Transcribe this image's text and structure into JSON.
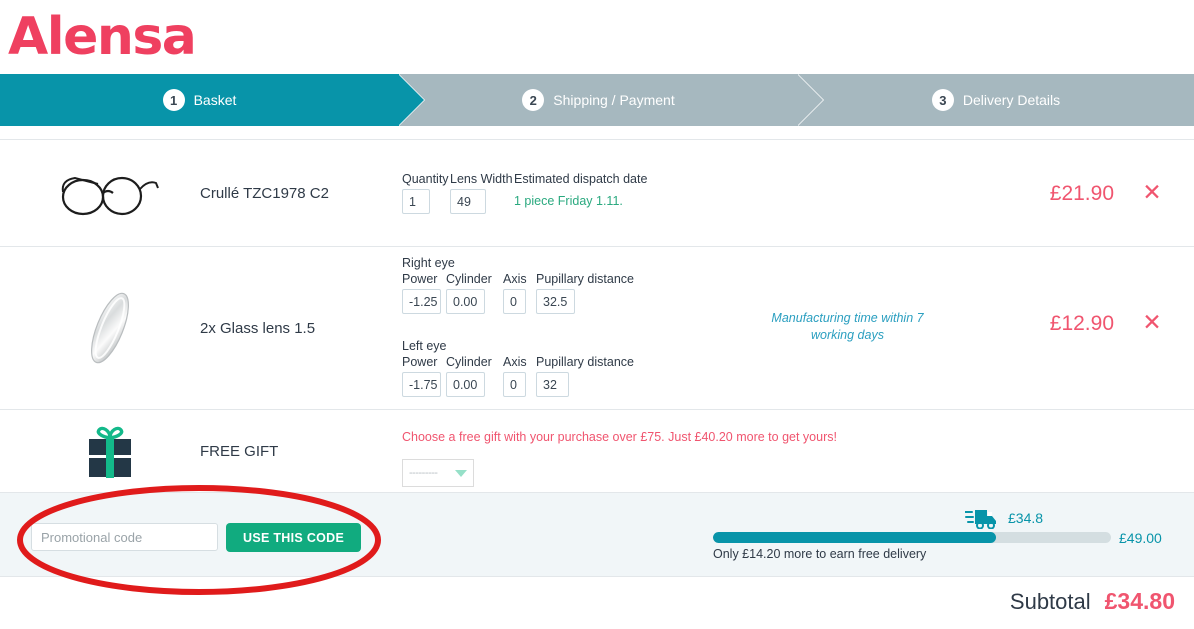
{
  "brand": {
    "name": "Alensa",
    "color": "#ef4060"
  },
  "theme": {
    "teal": "#0894a9",
    "grey_step": "#a6b8bf",
    "price_red": "#f0556f",
    "green_button": "#11ab7f",
    "dispatch_green": "#2aa97f",
    "note_blue": "#2b9fc0",
    "annotation_red": "#e01b1b"
  },
  "steps": [
    {
      "number": "1",
      "label": "Basket",
      "state": "active"
    },
    {
      "number": "2",
      "label": "Shipping / Payment",
      "state": "inactive"
    },
    {
      "number": "3",
      "label": "Delivery Details",
      "state": "inactive"
    }
  ],
  "items": [
    {
      "name": "Crullé TZC1978 C2",
      "thumb_icon": "eyeglasses-image",
      "price": "£21.90",
      "remove_label": "✕",
      "fields": [
        {
          "label": "Quantity",
          "value": "1"
        },
        {
          "label": "Lens Width",
          "value": "49"
        }
      ],
      "dispatch_header": "Estimated dispatch date",
      "dispatch_pieces": "1 piece",
      "dispatch_date": "Friday 1.11."
    },
    {
      "name": "2x Glass lens 1.5",
      "thumb_icon": "glass-lens-image",
      "price": "£12.90",
      "remove_label": "✕",
      "right_eye": {
        "title": "Right eye",
        "columns": [
          "Power",
          "Cylinder",
          "Axis",
          "Pupillary distance"
        ],
        "values": [
          "-1.25",
          "0.00",
          "0",
          "32.5"
        ]
      },
      "left_eye": {
        "title": "Left eye",
        "columns": [
          "Power",
          "Cylinder",
          "Axis",
          "Pupillary distance"
        ],
        "values": [
          "-1.75",
          "0.00",
          "0",
          "32"
        ]
      },
      "note": "Manufacturing time within 7 working days"
    }
  ],
  "free_gift": {
    "label": "FREE GIFT",
    "icon": "gift-icon",
    "message": "Choose a free gift with your purchase over £75. Just £40.20 more to get yours!",
    "select_value": "---------"
  },
  "promo": {
    "placeholder": "Promotional code",
    "value": "",
    "button_label": "USE THIS CODE"
  },
  "delivery": {
    "truck_icon": "delivery-truck-icon",
    "current_amount": "£34.8",
    "goal_amount": "£49.00",
    "progress_percent": 71,
    "note": "Only £14.20 more to earn free delivery"
  },
  "summary": {
    "subtotal_label": "Subtotal",
    "subtotal_value": "£34.80"
  }
}
